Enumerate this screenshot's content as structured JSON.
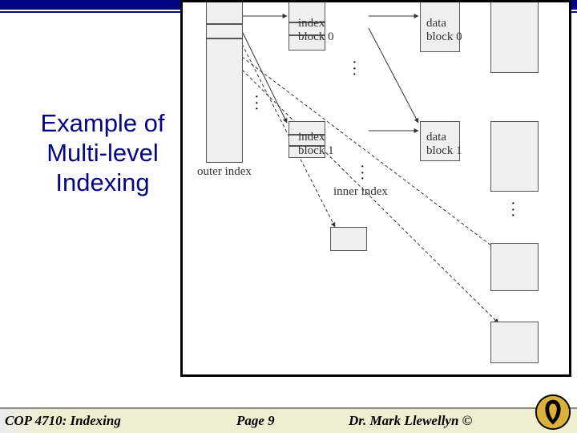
{
  "title": "Example of Multi-level Indexing",
  "diagram": {
    "outer_index_label": "outer index",
    "inner_index_label": "inner index",
    "index_block_0": "index block 0",
    "index_block_1": "index block 1",
    "data_block_0": "data block 0",
    "data_block_1": "data block 1"
  },
  "footer": {
    "course": "COP 4710: Indexing",
    "page": "Page 9",
    "author": "Dr. Mark Llewellyn ©"
  }
}
